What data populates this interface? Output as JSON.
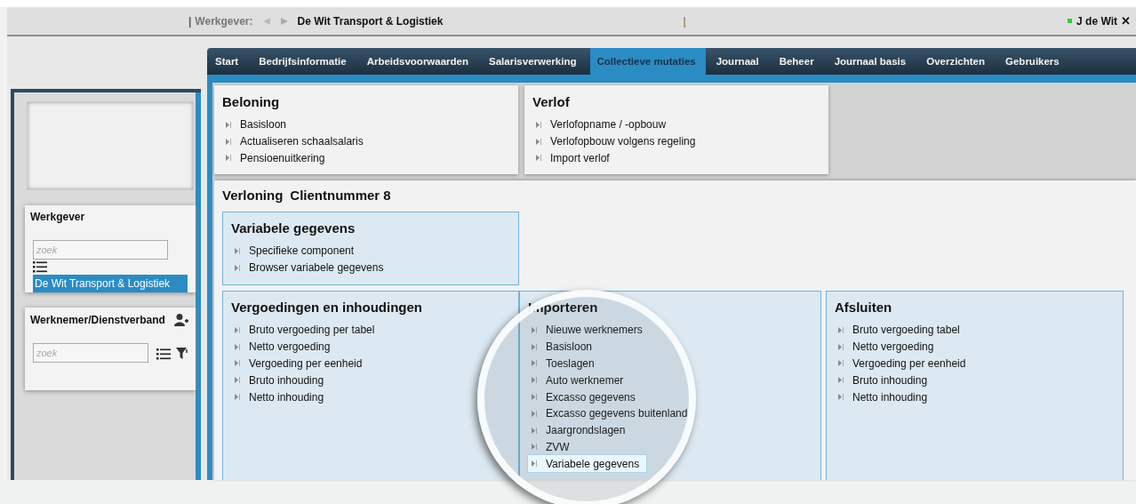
{
  "topbar": {
    "separator_left": "|",
    "employer_label": "Werkgever:",
    "employer": "De Wit Transport & Logistiek",
    "separator": "|",
    "user": "J de Wit",
    "online": true,
    "close": "✕"
  },
  "nav": {
    "tabs": [
      {
        "label": "Start",
        "selected": false
      },
      {
        "label": "Bedrijfsinformatie",
        "selected": false
      },
      {
        "label": "Arbeidsvoorwaarden",
        "selected": false
      },
      {
        "label": "Salarisverwerking",
        "selected": false
      },
      {
        "label": "Collectieve mutaties",
        "selected": true
      },
      {
        "label": "Journaal",
        "selected": false
      },
      {
        "label": "Beheer",
        "selected": false
      },
      {
        "label": "Journaal basis",
        "selected": false
      },
      {
        "label": "Overzichten",
        "selected": false
      },
      {
        "label": "Gebruikers",
        "selected": false
      }
    ]
  },
  "sidebar": {
    "werkgever": {
      "title": "Werkgever",
      "search": {
        "placeholder": "zoek"
      },
      "items": [
        {
          "label": "De Wit Transport & Logistiek",
          "selected": true
        }
      ]
    },
    "werknemer": {
      "title": "Werknemer/Dienstverband",
      "search": {
        "placeholder": "zoek"
      }
    }
  },
  "menus": [
    {
      "title": "Beloning",
      "items": [
        {
          "label": "Basisloon",
          "selected": false
        },
        {
          "label": "Actualiseren schaalsalaris",
          "selected": false
        },
        {
          "label": "Pensioenuitkering",
          "selected": false
        }
      ]
    },
    {
      "title": "Verlof",
      "items": [
        {
          "label": "Verlofopname / -opbouw",
          "selected": false
        },
        {
          "label": "Verlofopbouw volgens regeling",
          "selected": false
        },
        {
          "label": "Import verlof",
          "selected": false
        }
      ]
    }
  ],
  "section": {
    "title": "Verloning",
    "subtitle": "Clientnummer 8",
    "top_group": {
      "title": "Variabele gegevens",
      "items": [
        {
          "label": "Specifieke component",
          "selected": false
        },
        {
          "label": "Browser variabele gegevens",
          "selected": false
        }
      ]
    },
    "groups": [
      {
        "title": "Vergoedingen en inhoudingen",
        "items": [
          {
            "label": "Bruto vergoeding per tabel",
            "selected": false
          },
          {
            "label": "Netto vergoeding",
            "selected": false
          },
          {
            "label": "Vergoeding per eenheid",
            "selected": false
          },
          {
            "label": "Bruto inhouding",
            "selected": false
          },
          {
            "label": "Netto inhouding",
            "selected": false
          }
        ]
      },
      {
        "title": "Importeren",
        "items": [
          {
            "label": "Nieuwe werknemers",
            "selected": false
          },
          {
            "label": "Basisloon",
            "selected": false
          },
          {
            "label": "Toeslagen",
            "selected": false
          },
          {
            "label": "Auto werknemer",
            "selected": false
          },
          {
            "label": "Excasso gegevens",
            "selected": false
          },
          {
            "label": "Excasso gegevens buitenland",
            "selected": false
          },
          {
            "label": "Jaargrondslagen",
            "selected": false
          },
          {
            "label": "ZVW",
            "selected": false
          },
          {
            "label": "Variabele gegevens",
            "selected": true
          }
        ]
      },
      {
        "title": "Afsluiten",
        "items": [
          {
            "label": "Bruto vergoeding tabel",
            "selected": false
          },
          {
            "label": "Netto vergoeding",
            "selected": false
          },
          {
            "label": "Vergoeding per eenheid",
            "selected": false
          },
          {
            "label": "Bruto inhouding",
            "selected": false
          },
          {
            "label": "Netto inhouding",
            "selected": false
          }
        ]
      }
    ]
  }
}
